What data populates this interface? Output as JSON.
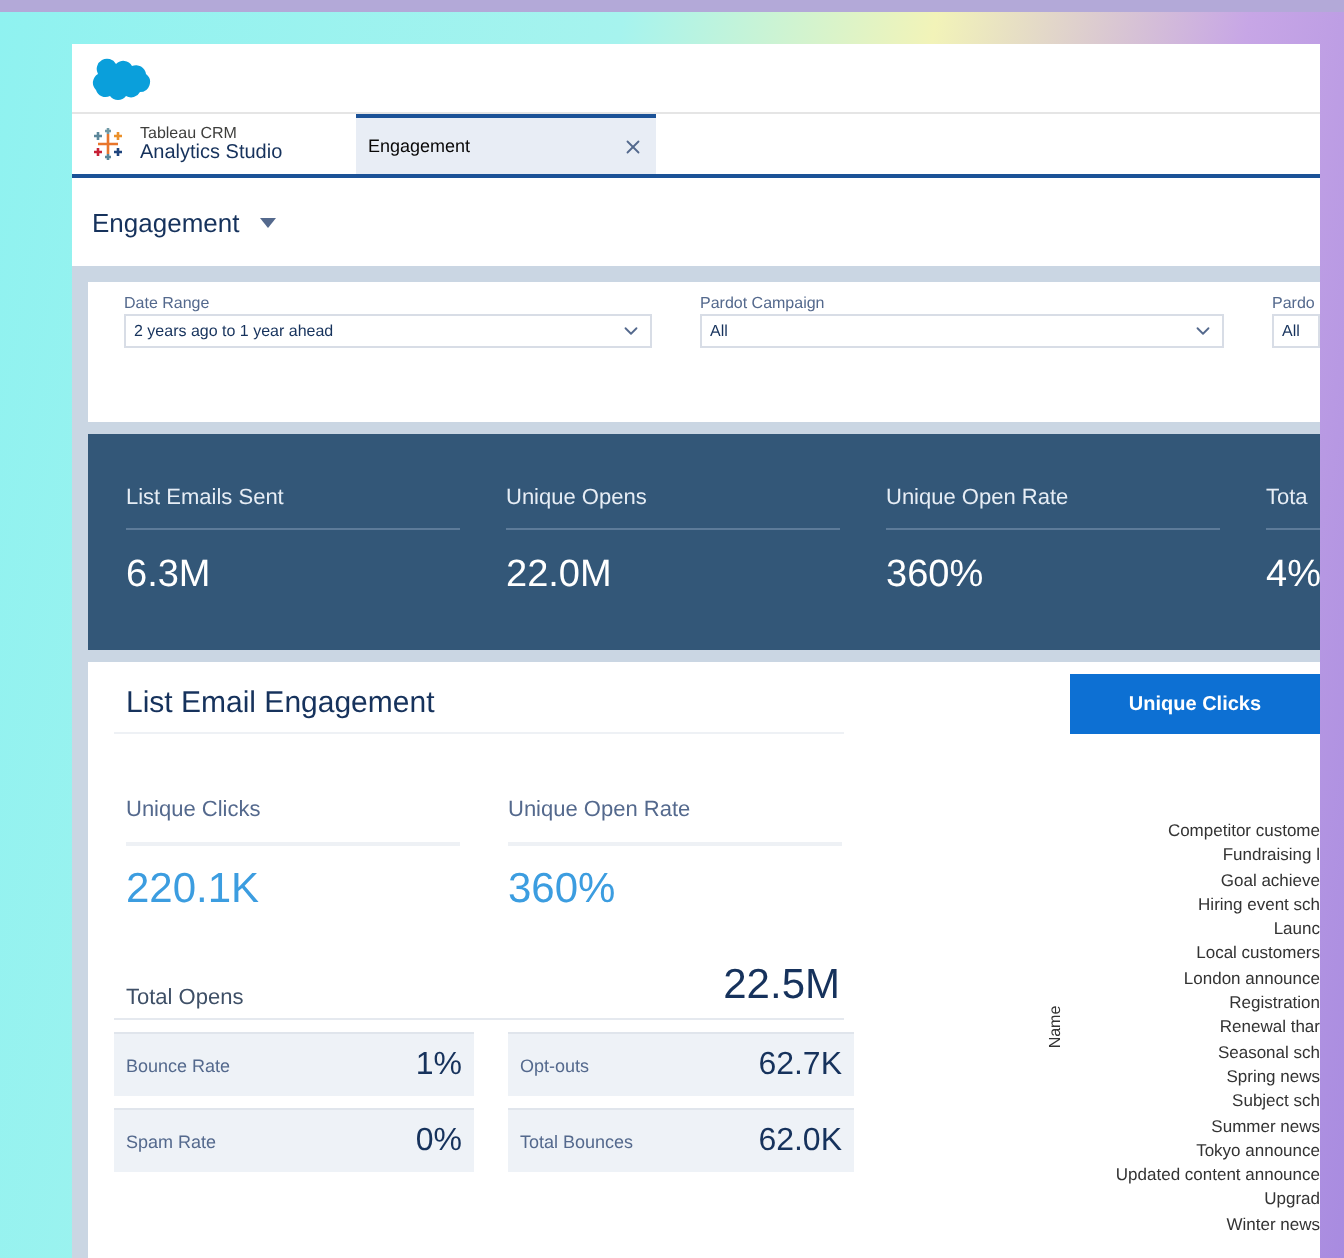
{
  "app": {
    "line_1": "Tableau CRM",
    "line_2": "Analytics Studio"
  },
  "tabs": [
    {
      "label": "Engagement",
      "selected": true
    }
  ],
  "dashboard_title": "Engagement",
  "filters": [
    {
      "label": "Date Range",
      "value": "2 years ago to 1 year ahead"
    },
    {
      "label": "Pardot Campaign",
      "value": "All"
    },
    {
      "label": "Pardo",
      "value": "All"
    }
  ],
  "kpis": [
    {
      "label": "List Emails Sent",
      "value": "6.3M"
    },
    {
      "label": "Unique Opens",
      "value": "22.0M"
    },
    {
      "label": "Unique Open Rate",
      "value": "360%"
    },
    {
      "label": "Tota",
      "value": "4%"
    }
  ],
  "engagement": {
    "title": "List Email Engagement",
    "metrics": [
      {
        "label": "Unique Clicks",
        "value": "220.1K"
      },
      {
        "label": "Unique Open Rate",
        "value": "360%"
      }
    ],
    "total": {
      "label": "Total Opens",
      "value": "22.5M"
    },
    "stats": [
      {
        "label": "Bounce Rate",
        "value": "1%"
      },
      {
        "label": "Opt-outs",
        "value": "62.7K"
      },
      {
        "label": "Spam Rate",
        "value": "0%"
      },
      {
        "label": "Total Bounces",
        "value": "62.0K"
      }
    ]
  },
  "chart": {
    "button": "Unique Clicks",
    "axis_title": "Name",
    "categories": [
      "Competitor custome",
      "Fundraising l",
      "Goal achieve",
      "Hiring event sch",
      "Launc",
      "Local customers",
      "London announce",
      "Registration",
      "Renewal thar",
      "Seasonal sch",
      "Spring news",
      "Subject sch",
      "Summer news",
      "Tokyo announce",
      "Updated content announce",
      "Upgrad",
      "Winter news"
    ]
  }
}
